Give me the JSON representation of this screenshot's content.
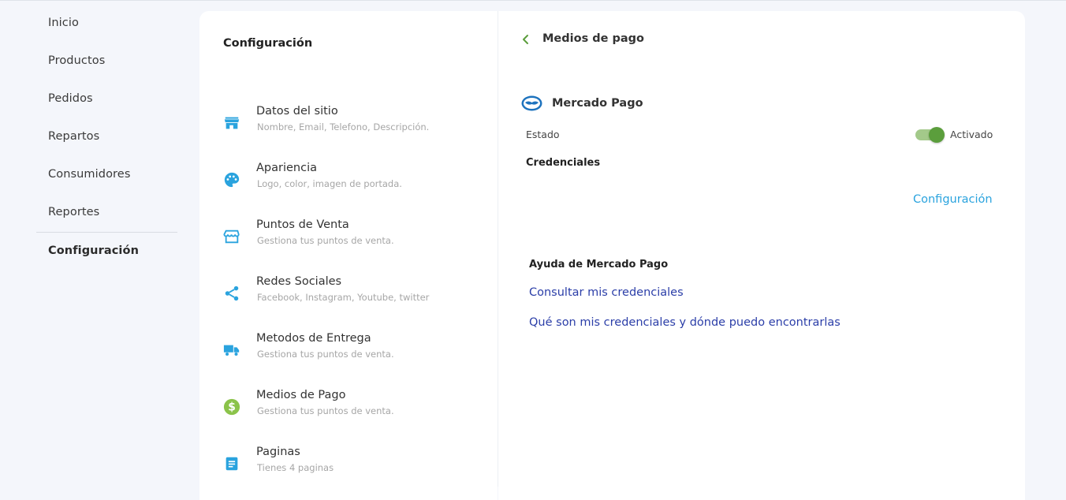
{
  "sidebar": {
    "items": [
      {
        "label": "Inicio"
      },
      {
        "label": "Productos"
      },
      {
        "label": "Pedidos"
      },
      {
        "label": "Repartos"
      },
      {
        "label": "Consumidores"
      },
      {
        "label": "Reportes"
      },
      {
        "label": "Configuración",
        "active": true
      }
    ]
  },
  "settings": {
    "title": "Configuración",
    "items": [
      {
        "title": "Datos del sitio",
        "subtitle": "Nombre, Email, Telefono, Descripción.",
        "icon": "store-icon"
      },
      {
        "title": "Apariencia",
        "subtitle": "Logo, color, imagen de portada.",
        "icon": "palette-icon"
      },
      {
        "title": "Puntos de Venta",
        "subtitle": "Gestiona tus puntos de venta.",
        "icon": "storefront-icon"
      },
      {
        "title": "Redes Sociales",
        "subtitle": "Facebook, Instagram, Youtube, twitter",
        "icon": "share-icon"
      },
      {
        "title": "Metodos de Entrega",
        "subtitle": "Gestiona tus puntos de venta.",
        "icon": "truck-icon"
      },
      {
        "title": "Medios de Pago",
        "subtitle": "Gestiona tus puntos de venta.",
        "icon": "dollar-icon"
      },
      {
        "title": "Paginas",
        "subtitle": "Tienes 4 paginas",
        "icon": "document-icon"
      }
    ]
  },
  "detail": {
    "back_icon": "chevron-left-icon",
    "title": "Medios de pago",
    "provider": {
      "logo_icon": "mercado-pago-logo",
      "name": "Mercado Pago"
    },
    "status": {
      "label": "Estado",
      "enabled": true,
      "value_label": "Activado"
    },
    "credentials": {
      "title": "Credenciales",
      "config_link": "Configuración"
    },
    "help": {
      "title": "Ayuda de Mercado Pago",
      "links": [
        "Consultar mis credenciales",
        "Qué son mis credenciales y dónde puedo encontrarlas"
      ]
    }
  },
  "colors": {
    "background": "#f4f6fb",
    "icon_blue": "#2aa3de",
    "icon_green": "#8bc34a",
    "toggle_on": "#5b9e3c",
    "link": "#2b3ea8"
  }
}
